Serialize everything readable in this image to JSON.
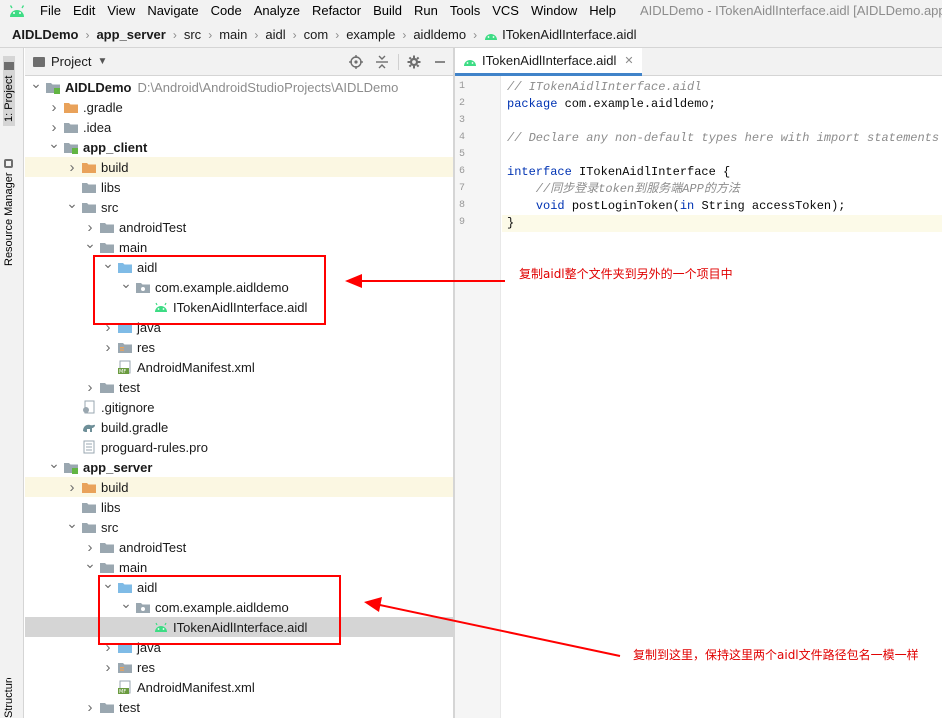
{
  "menubar": {
    "items": [
      "File",
      "Edit",
      "View",
      "Navigate",
      "Code",
      "Analyze",
      "Refactor",
      "Build",
      "Run",
      "Tools",
      "VCS",
      "Window",
      "Help"
    ],
    "window_title": "AIDLDemo - ITokenAidlInterface.aidl [AIDLDemo.app"
  },
  "breadcrumb": [
    "AIDLDemo",
    "app_server",
    "src",
    "main",
    "aidl",
    "com",
    "example",
    "aidldemo",
    "ITokenAidlInterface.aidl"
  ],
  "toolstrip": {
    "project_tab": "1: Project",
    "resource_tab": "Resource Manager",
    "structure_tab": "Structure"
  },
  "project_panel": {
    "title": "Project",
    "root_path": "D:\\Android\\AndroidStudioProjects\\AIDLDemo"
  },
  "tree": [
    {
      "label": "AIDLDemo",
      "depth": 0,
      "expanded": true,
      "icon": "module-icon",
      "bold": true
    },
    {
      "label": ".gradle",
      "depth": 1,
      "expanded": false,
      "icon": "folder-orange-icon"
    },
    {
      "label": ".idea",
      "depth": 1,
      "expanded": false,
      "icon": "folder-gray-icon"
    },
    {
      "label": "app_client",
      "depth": 1,
      "expanded": true,
      "icon": "module-icon",
      "bold": true
    },
    {
      "label": "build",
      "depth": 2,
      "expanded": false,
      "icon": "folder-orange-icon",
      "highlight": true
    },
    {
      "label": "libs",
      "depth": 2,
      "expanded": null,
      "icon": "folder-gray-icon"
    },
    {
      "label": "src",
      "depth": 2,
      "expanded": true,
      "icon": "folder-gray-icon"
    },
    {
      "label": "androidTest",
      "depth": 3,
      "expanded": false,
      "icon": "folder-gray-icon"
    },
    {
      "label": "main",
      "depth": 3,
      "expanded": true,
      "icon": "folder-gray-icon"
    },
    {
      "label": "aidl",
      "depth": 4,
      "expanded": true,
      "icon": "folder-blue-icon"
    },
    {
      "label": "com.example.aidldemo",
      "depth": 5,
      "expanded": true,
      "icon": "package-icon"
    },
    {
      "label": "ITokenAidlInterface.aidl",
      "depth": 6,
      "expanded": null,
      "icon": "android-file-icon"
    },
    {
      "label": "java",
      "depth": 4,
      "expanded": false,
      "icon": "folder-blue-icon"
    },
    {
      "label": "res",
      "depth": 4,
      "expanded": false,
      "icon": "folder-res-icon"
    },
    {
      "label": "AndroidManifest.xml",
      "depth": 4,
      "expanded": null,
      "icon": "manifest-icon"
    },
    {
      "label": "test",
      "depth": 3,
      "expanded": false,
      "icon": "folder-gray-icon"
    },
    {
      "label": ".gitignore",
      "depth": 2,
      "expanded": null,
      "icon": "gitignore-icon"
    },
    {
      "label": "build.gradle",
      "depth": 2,
      "expanded": null,
      "icon": "gradle-icon"
    },
    {
      "label": "proguard-rules.pro",
      "depth": 2,
      "expanded": null,
      "icon": "text-file-icon"
    },
    {
      "label": "app_server",
      "depth": 1,
      "expanded": true,
      "icon": "module-icon",
      "bold": true
    },
    {
      "label": "build",
      "depth": 2,
      "expanded": false,
      "icon": "folder-orange-icon",
      "highlight": true
    },
    {
      "label": "libs",
      "depth": 2,
      "expanded": null,
      "icon": "folder-gray-icon"
    },
    {
      "label": "src",
      "depth": 2,
      "expanded": true,
      "icon": "folder-gray-icon"
    },
    {
      "label": "androidTest",
      "depth": 3,
      "expanded": false,
      "icon": "folder-gray-icon"
    },
    {
      "label": "main",
      "depth": 3,
      "expanded": true,
      "icon": "folder-gray-icon"
    },
    {
      "label": "aidl",
      "depth": 4,
      "expanded": true,
      "icon": "folder-blue-icon"
    },
    {
      "label": "com.example.aidldemo",
      "depth": 5,
      "expanded": true,
      "icon": "package-icon"
    },
    {
      "label": "ITokenAidlInterface.aidl",
      "depth": 6,
      "expanded": null,
      "icon": "android-file-icon",
      "selected": true
    },
    {
      "label": "java",
      "depth": 4,
      "expanded": false,
      "icon": "folder-blue-icon"
    },
    {
      "label": "res",
      "depth": 4,
      "expanded": false,
      "icon": "folder-res-icon"
    },
    {
      "label": "AndroidManifest.xml",
      "depth": 4,
      "expanded": null,
      "icon": "manifest-icon"
    },
    {
      "label": "test",
      "depth": 3,
      "expanded": false,
      "icon": "folder-gray-icon"
    }
  ],
  "editor": {
    "tab_label": "ITokenAidlInterface.aidl",
    "current_line": 9,
    "lines": [
      [
        {
          "t": "// ITokenAidlInterface.aidl",
          "c": "cmt"
        }
      ],
      [
        {
          "t": "package ",
          "c": "kw"
        },
        {
          "t": "com.example.aidldemo;",
          "c": "plain"
        }
      ],
      [],
      [
        {
          "t": "// Declare any non-default types here with import statements",
          "c": "cmt"
        }
      ],
      [],
      [
        {
          "t": "interface ",
          "c": "kw"
        },
        {
          "t": "ITokenAidlInterface {",
          "c": "plain"
        }
      ],
      [
        {
          "t": "    //同步登录token到服务端APP的方法",
          "c": "cmt"
        }
      ],
      [
        {
          "t": "    ",
          "c": "plain"
        },
        {
          "t": "void ",
          "c": "kw"
        },
        {
          "t": "postLoginToken(",
          "c": "plain"
        },
        {
          "t": "in ",
          "c": "kw"
        },
        {
          "t": "String accessToken);",
          "c": "plain"
        }
      ],
      [
        {
          "t": "}",
          "c": "plain"
        }
      ]
    ]
  },
  "annotations": {
    "note_1": "复制aidl整个文件夹到另外的一个项目中",
    "note_2": "复制到这里，保持这里两个aidl文件路径包名一模一样",
    "color": "#ff0000"
  }
}
